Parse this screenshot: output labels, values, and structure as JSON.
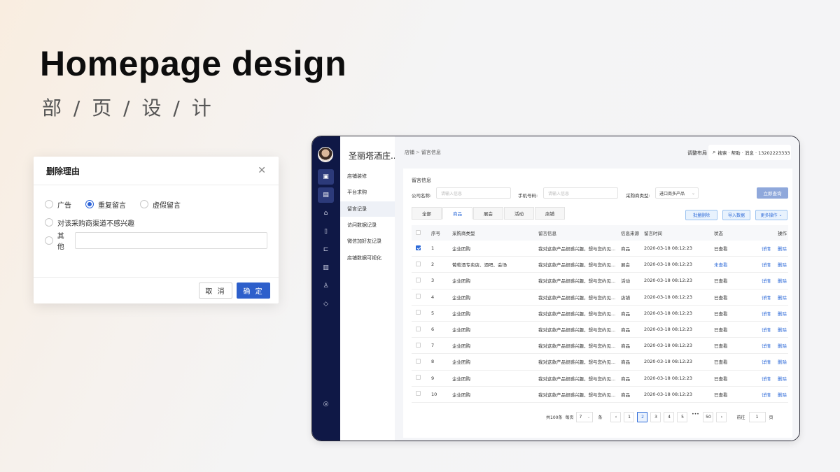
{
  "hero": {
    "title": "Homepage design",
    "subtitle": "部 / 页 / 设  / 计"
  },
  "dialog": {
    "title": "删除理由",
    "options": [
      "广告",
      "重复留言",
      "虚假留言",
      "对该采购商渠道不感兴趣",
      "其他"
    ],
    "selected": "重复留言",
    "cancel": "取 消",
    "ok": "确 定"
  },
  "app": {
    "shop_name": "圣丽塔酒庄...",
    "subnav": [
      "店铺装修",
      "平台求购",
      "留言记录",
      "访问数据记录",
      "微信加好友记录",
      "店铺数据可视化"
    ],
    "subnav_active": "留言记录",
    "breadcrumb": [
      "店铺",
      "留言信息"
    ],
    "layout_link": "调整布局",
    "top_search": "搜索 · 帮助 · 消息 · 13202223333",
    "panel_title": "留言信息",
    "filters": {
      "company_label": "公司名称:",
      "company_placeholder": "请输入信息",
      "phone_label": "手机号码:",
      "phone_placeholder": "请输入信息",
      "buyer_type_label": "采购商类型:",
      "buyer_type_value": "进口商多产品",
      "query_button": "立即查询"
    },
    "tabs": [
      "全部",
      "商品",
      "展会",
      "活动",
      "店铺"
    ],
    "tab_active": "商品",
    "tools": {
      "batch_delete": "批量删除",
      "import": "导入数据",
      "more": "更多操作"
    },
    "table": {
      "headers": [
        "序号",
        "采购商类型",
        "留言信息",
        "信息来源",
        "留言时间",
        "状态",
        "操作"
      ],
      "rows": [
        {
          "no": "1",
          "type": "企业团购",
          "info": "我对这款产品很感兴趣，想与您约见...",
          "source": "商品",
          "time": "2020-03-18  08:12:23",
          "status": "已查看",
          "checked": true
        },
        {
          "no": "2",
          "type": "葡萄酒专卖店、酒吧、会场",
          "info": "我对这款产品很感兴趣，想与您约见...",
          "source": "展会",
          "time": "2020-03-18  08:12:23",
          "status": "未查看",
          "checked": false
        },
        {
          "no": "3",
          "type": "企业团购",
          "info": "我对这款产品很感兴趣，想与您约见...",
          "source": "活动",
          "time": "2020-03-18  08:12:23",
          "status": "已查看",
          "checked": false
        },
        {
          "no": "4",
          "type": "企业团购",
          "info": "我对这款产品很感兴趣，想与您约见...",
          "source": "店铺",
          "time": "2020-03-18  08:12:23",
          "status": "已查看",
          "checked": false
        },
        {
          "no": "5",
          "type": "企业团购",
          "info": "我对这款产品很感兴趣，想与您约见...",
          "source": "商品",
          "time": "2020-03-18  08:12:23",
          "status": "已查看",
          "checked": false
        },
        {
          "no": "6",
          "type": "企业团购",
          "info": "我对这款产品很感兴趣，想与您约见...",
          "source": "商品",
          "time": "2020-03-18  08:12:23",
          "status": "已查看",
          "checked": false
        },
        {
          "no": "7",
          "type": "企业团购",
          "info": "我对这款产品很感兴趣，想与您约见...",
          "source": "商品",
          "time": "2020-03-18  08:12:23",
          "status": "已查看",
          "checked": false
        },
        {
          "no": "8",
          "type": "企业团购",
          "info": "我对这款产品很感兴趣，想与您约见...",
          "source": "商品",
          "time": "2020-03-18  08:12:23",
          "status": "已查看",
          "checked": false
        },
        {
          "no": "9",
          "type": "企业团购",
          "info": "我对这款产品很感兴趣，想与您约见...",
          "source": "商品",
          "time": "2020-03-18  08:12:23",
          "status": "已查看",
          "checked": false
        },
        {
          "no": "10",
          "type": "企业团购",
          "info": "我对这款产品很感兴趣，想与您约见...",
          "source": "商品",
          "time": "2020-03-18  08:12:23",
          "status": "已查看",
          "checked": false
        }
      ],
      "action_detail": "详情",
      "action_delete": "删除"
    },
    "pagination": {
      "total": "共100条",
      "per_page_label": "每页",
      "per_page_value": "7",
      "per_page_unit": "条",
      "pages": [
        "1",
        "2",
        "3",
        "4",
        "5",
        "•••",
        "50"
      ],
      "current": "2",
      "goto_label": "前往",
      "goto_value": "1",
      "goto_unit": "页"
    }
  },
  "colors": {
    "accent": "#2d5fcb",
    "rail": "#0f1846",
    "link": "#2d6ad8"
  }
}
